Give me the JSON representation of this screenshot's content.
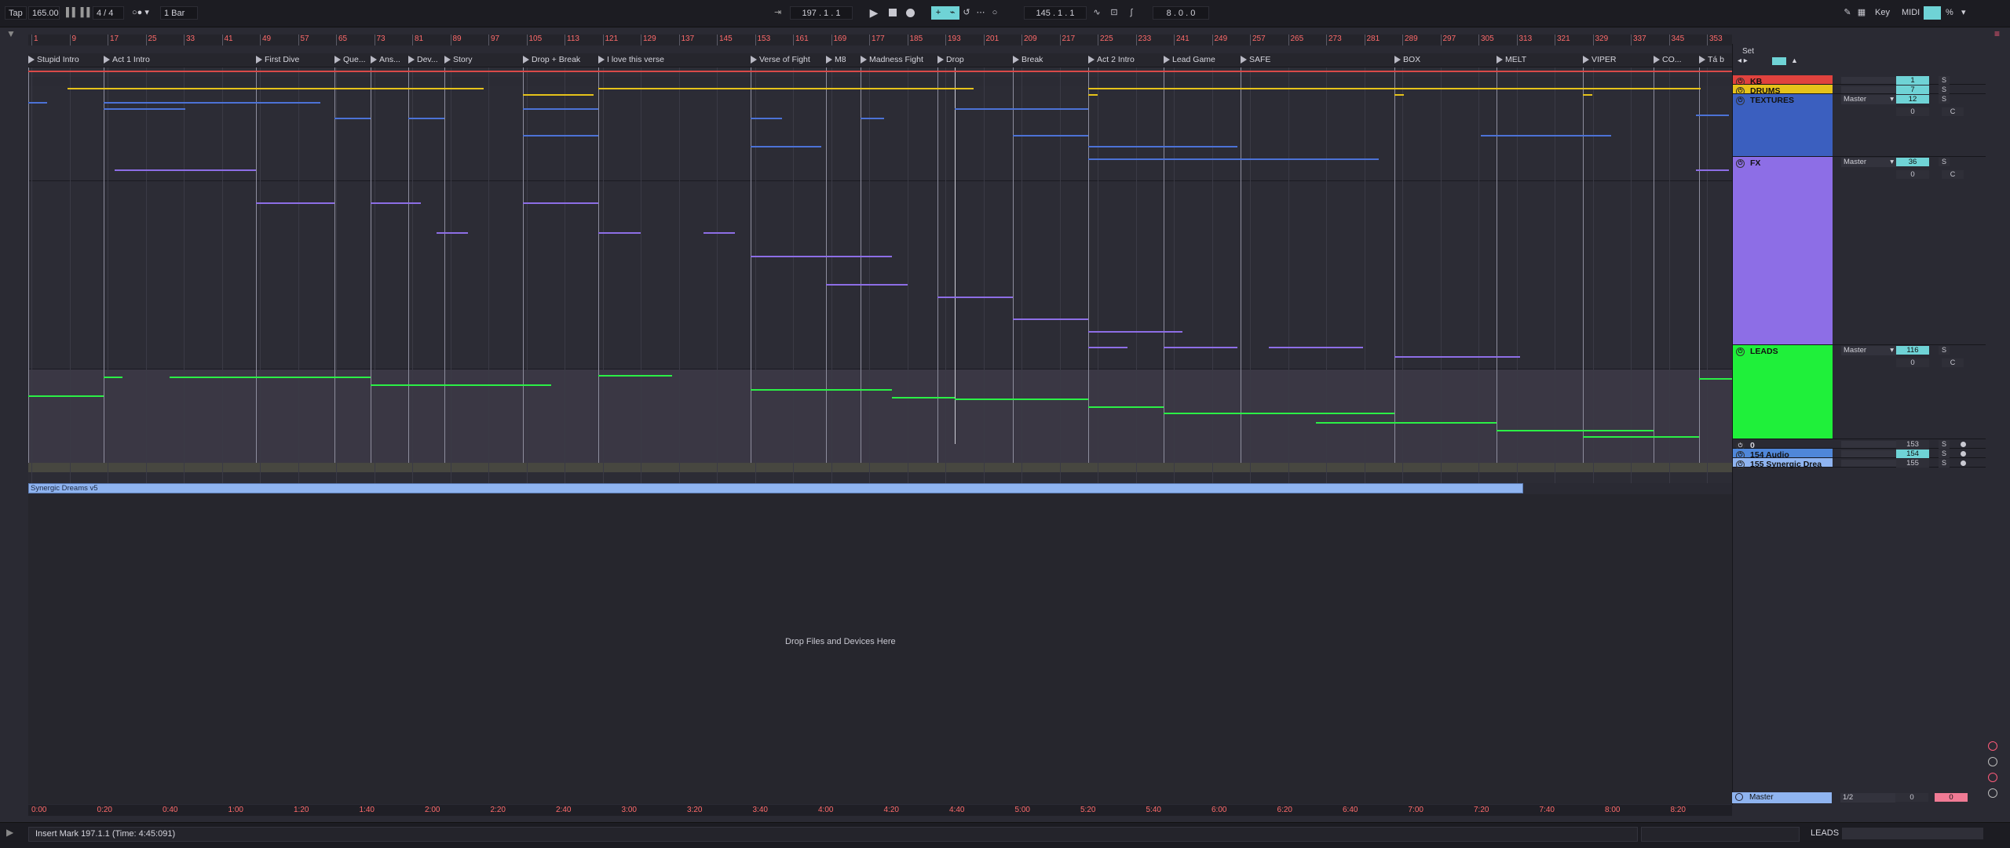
{
  "transport": {
    "tap": "Tap",
    "tempo": "165.00",
    "time_sig": "4 / 4",
    "quantize": "1 Bar",
    "position": "197 .   1 .   1",
    "loop_start": "145 .   1 .   1",
    "loop_length": "8 .   0 .   0",
    "key_label": "Key",
    "midi_label": "MIDI",
    "cpu": "%"
  },
  "set_label": "Set",
  "ruler_bars": [
    "1",
    "9",
    "17",
    "25",
    "33",
    "41",
    "49",
    "57",
    "65",
    "73",
    "81",
    "89",
    "97",
    "105",
    "113",
    "121",
    "129",
    "137",
    "145",
    "153",
    "161",
    "169",
    "177",
    "185",
    "193",
    "201",
    "209",
    "217",
    "225",
    "233",
    "241",
    "249",
    "257",
    "265",
    "273",
    "281",
    "289",
    "297",
    "305",
    "313",
    "321",
    "329",
    "337",
    "345",
    "353"
  ],
  "locators": [
    "Stupid Intro",
    "Act 1 Intro",
    "First Dive",
    "Que...",
    "Ans...",
    "Dev...",
    "Story",
    "Drop + Break",
    "I love this verse",
    "Verse of Fight",
    "M8",
    "Madness Fight",
    "Drop",
    "Break",
    "Act 2 Intro",
    "Lead Game",
    "SAFE",
    "BOX",
    "MELT",
    "VIPER",
    "CO...",
    "Tá b"
  ],
  "tracks": [
    {
      "name": "KB",
      "color": "#e0423e",
      "volume": "1",
      "solo": "S"
    },
    {
      "name": "DRUMS",
      "color": "#e6c21a",
      "volume": "7",
      "solo": "S"
    },
    {
      "name": "TEXTURES",
      "color": "#3b5fbf",
      "volume": "12",
      "route": "Master",
      "send": "0",
      "solo": "S",
      "pan": "C"
    },
    {
      "name": "FX",
      "color": "#8d6ee6",
      "volume": "36",
      "route": "Master",
      "send": "0",
      "solo": "S",
      "pan": "C"
    },
    {
      "name": "LEADS",
      "color": "#1ff03a",
      "volume": "116",
      "route": "Master",
      "send": "0",
      "solo": "S",
      "pan": "C"
    },
    {
      "name": "0",
      "color": "#2a2a33",
      "volume": "153",
      "solo": "S"
    },
    {
      "name": "154 Audio",
      "color": "#4f87d9",
      "volume": "154",
      "solo": "S"
    },
    {
      "name": "155 Synergic Drea",
      "color": "#8fb4f0",
      "volume": "155",
      "solo": "S"
    }
  ],
  "clip_label": "Synergic Dreams v5",
  "drop_message": "Drop Files and Devices Here",
  "time_ruler": [
    "0:00",
    "0:20",
    "0:40",
    "1:00",
    "1:20",
    "1:40",
    "2:00",
    "2:20",
    "2:40",
    "3:00",
    "3:20",
    "3:40",
    "4:00",
    "4:20",
    "4:40",
    "5:00",
    "5:20",
    "5:40",
    "6:00",
    "6:20",
    "6:40",
    "7:00",
    "7:20",
    "7:40",
    "8:00",
    "8:20"
  ],
  "master": {
    "name": "Master",
    "route": "1/2",
    "send": "0",
    "volume": "0"
  },
  "status": {
    "message": "Insert Mark 197.1.1 (Time: 4:45:091)",
    "selected_track": "LEADS"
  },
  "icons": [
    "play-icon",
    "stop-icon",
    "record-icon",
    "metronome-icon",
    "pencil-icon",
    "keyboard-icon",
    "loop-icon",
    "chevron-down-icon"
  ]
}
